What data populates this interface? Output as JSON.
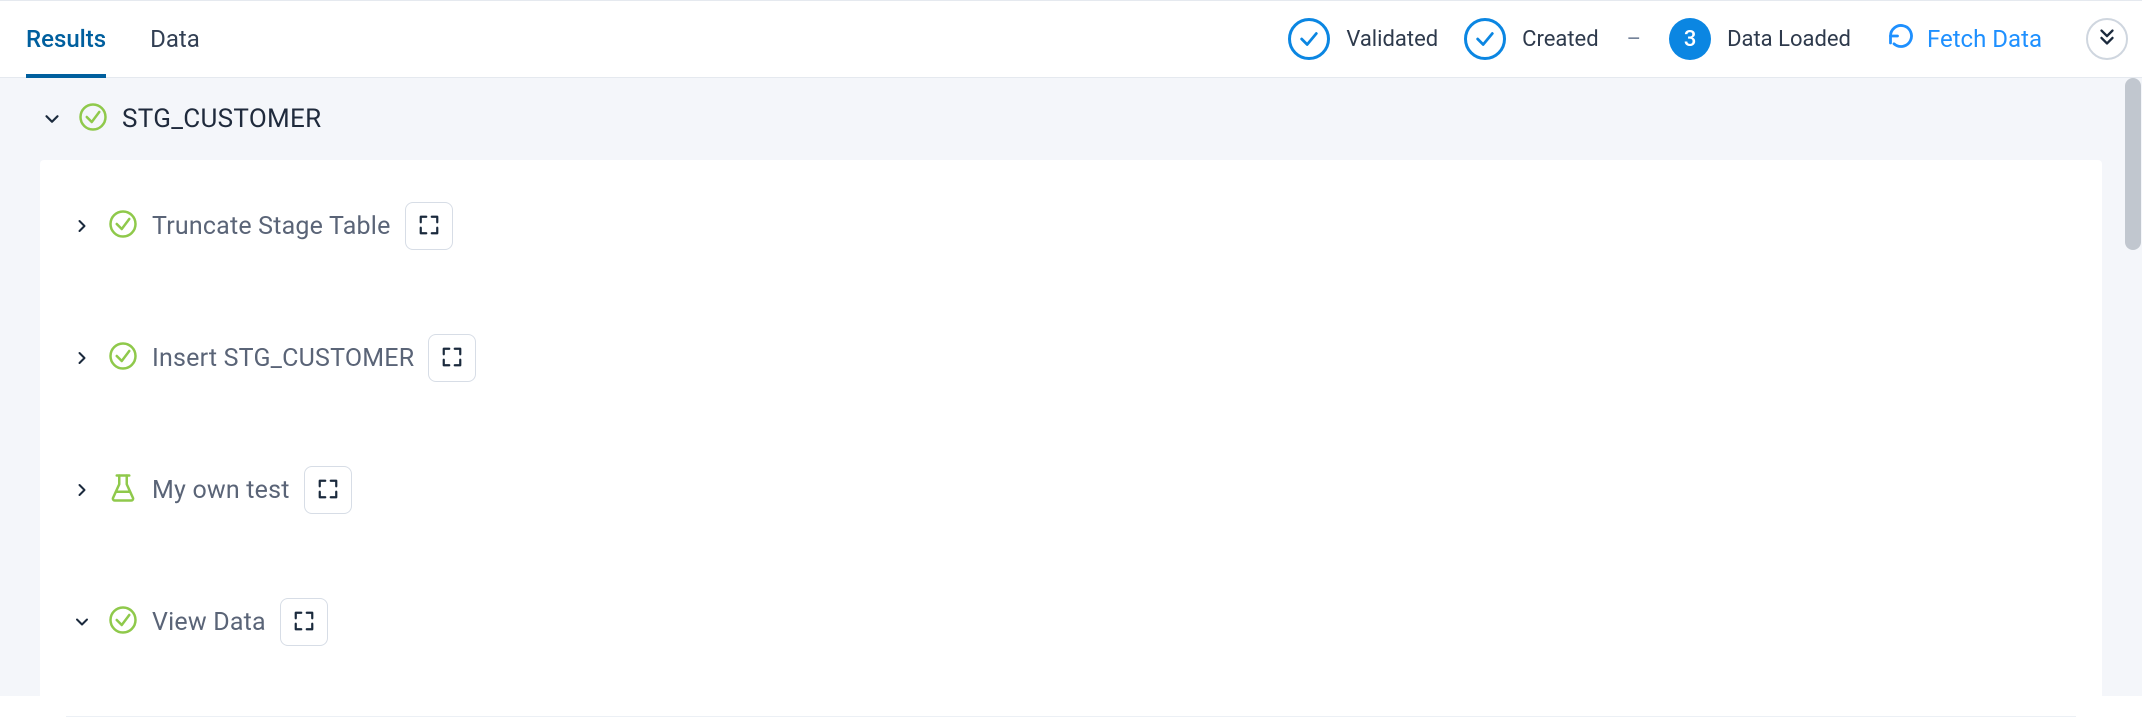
{
  "tabs": {
    "results": "Results",
    "data": "Data"
  },
  "status": {
    "validated": "Validated",
    "created": "Created",
    "separator": "–",
    "data_loaded_count": "3",
    "data_loaded": "Data Loaded"
  },
  "actions": {
    "fetch_data": "Fetch Data"
  },
  "group": {
    "title": "STG_CUSTOMER"
  },
  "steps": [
    {
      "label": "Truncate Stage Table",
      "icon": "success"
    },
    {
      "label": "Insert STG_CUSTOMER",
      "icon": "success"
    },
    {
      "label": "My own test",
      "icon": "flask"
    },
    {
      "label": "View Data",
      "icon": "success"
    }
  ]
}
